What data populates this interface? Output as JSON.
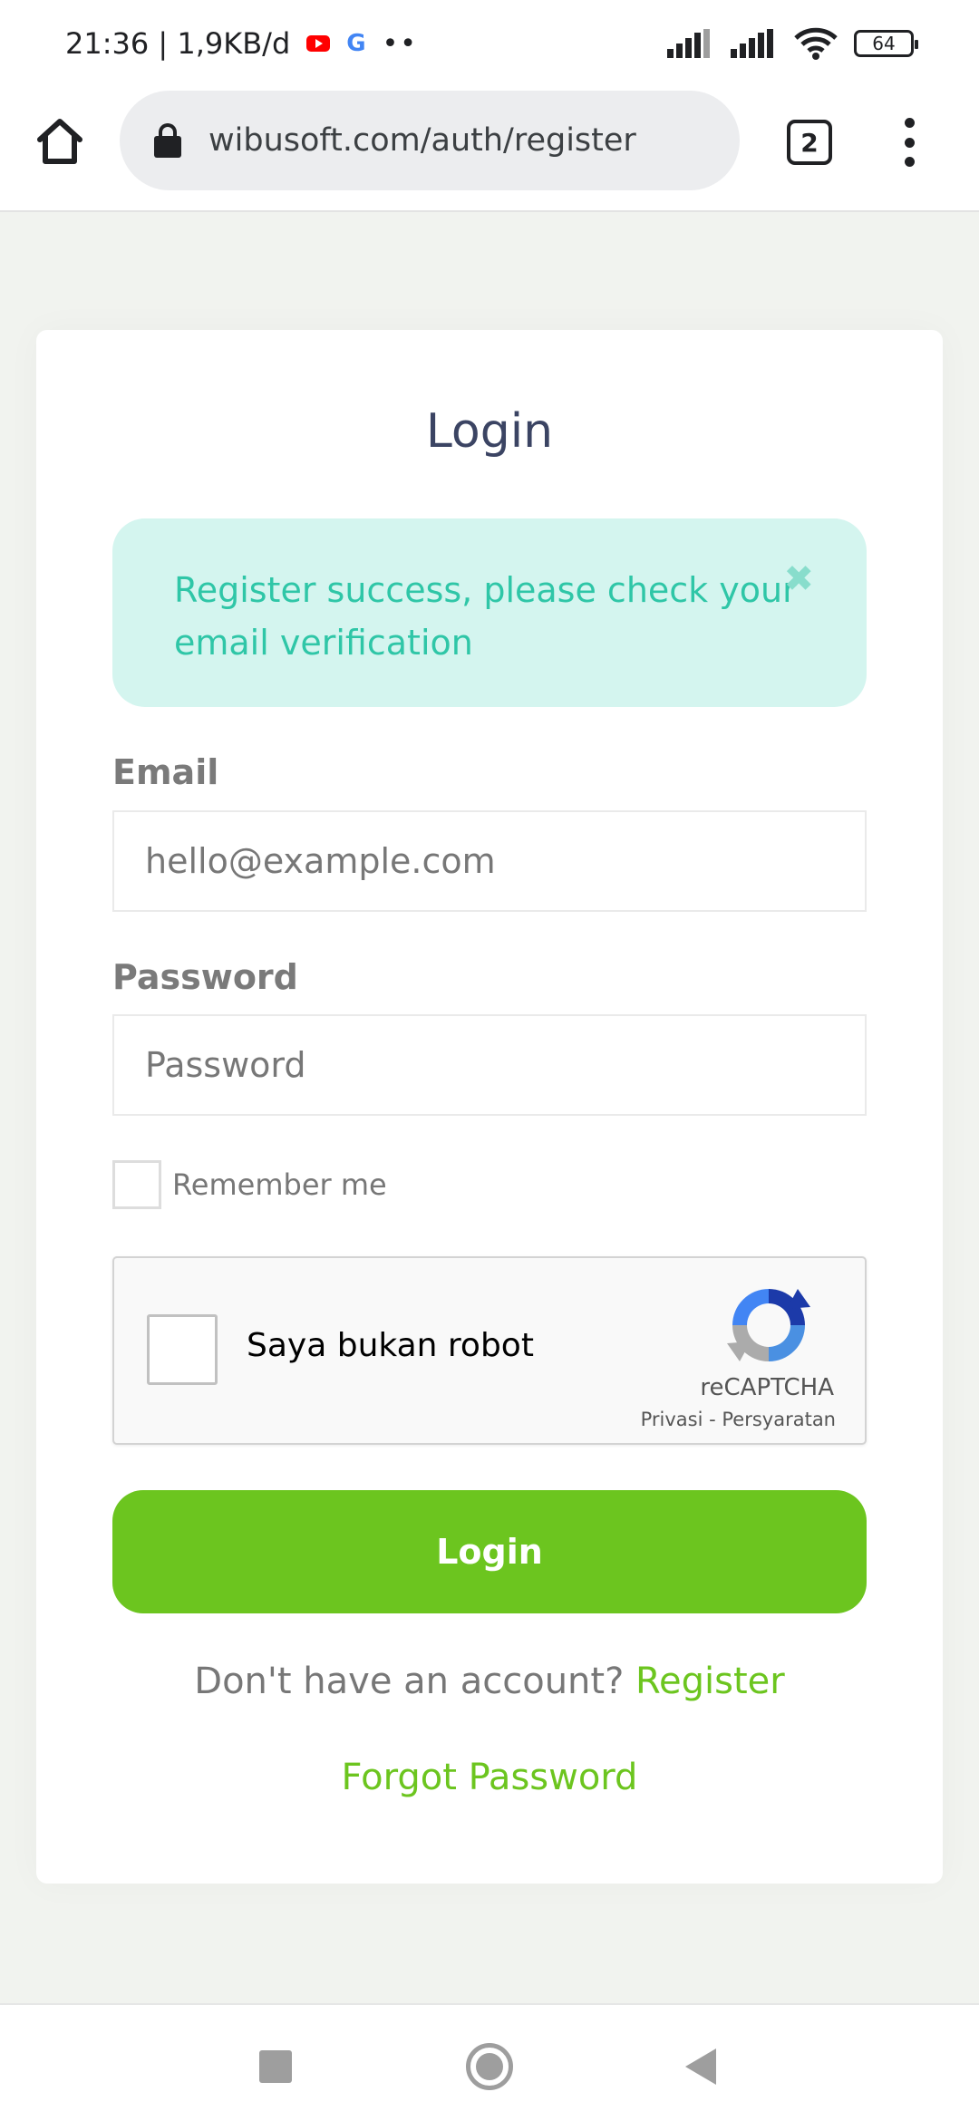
{
  "status_bar": {
    "time_speed": "21:36 | 1,9KB/d",
    "notification_dots": "••",
    "battery": "64"
  },
  "browser": {
    "url": "wibusoft.com/auth/register",
    "tab_count": "2"
  },
  "login_card": {
    "title": "Login",
    "alert": {
      "message": "Register success, please check your email verification",
      "close_symbol": "✖"
    },
    "email": {
      "label": "Email",
      "placeholder": "hello@example.com",
      "value": ""
    },
    "password": {
      "label": "Password",
      "placeholder": "Password",
      "value": ""
    },
    "remember_me": {
      "label": "Remember me",
      "checked": false
    },
    "recaptcha": {
      "label": "Saya bukan robot",
      "brand": "reCAPTCHA",
      "links": "Privasi - Persyaratan"
    },
    "login_button": "Login",
    "register_prompt": "Don't have an account?",
    "register_link": "Register",
    "forgot_password": "Forgot Password"
  },
  "colors": {
    "accent_green": "#6cc51f",
    "alert_bg": "#d4f5ef",
    "alert_text": "#2fc6a7",
    "title_text": "#3b4463",
    "page_bg": "#f1f3ef"
  },
  "icons": {
    "status": [
      "youtube-icon",
      "google-icon",
      "signal-icon",
      "wifi-icon",
      "battery-icon"
    ],
    "browser": [
      "home-icon",
      "lock-icon",
      "tabs-icon",
      "more-vert-icon"
    ],
    "nav": [
      "recents-icon",
      "home-circle-icon",
      "back-icon"
    ]
  }
}
